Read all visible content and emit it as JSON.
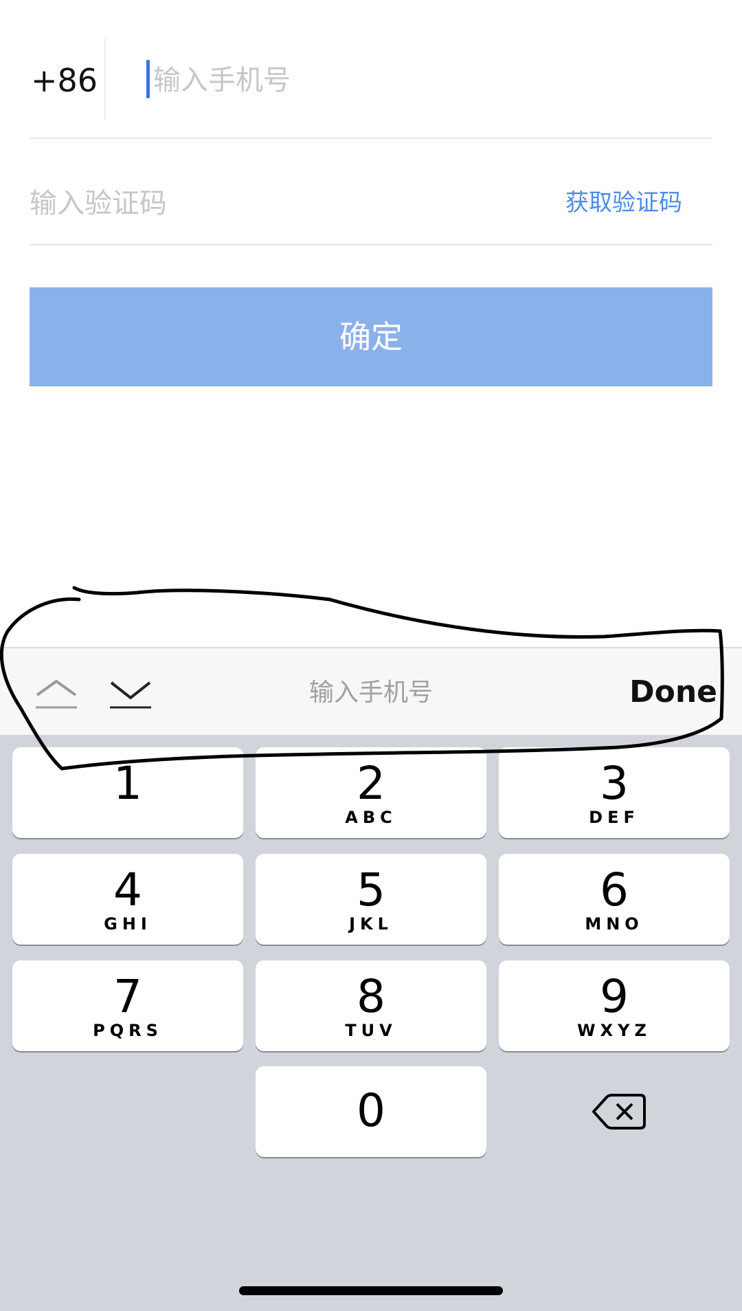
{
  "form": {
    "country_code": "+86",
    "phone_placeholder": "输入手机号",
    "code_placeholder": "输入验证码",
    "get_code_label": "获取验证码",
    "confirm_label": "确定"
  },
  "toolbar": {
    "prev_icon": "chevron-up-icon",
    "next_icon": "chevron-down-icon",
    "title": "输入手机号",
    "done_label": "Done"
  },
  "keypad": {
    "keys": [
      {
        "digit": "1",
        "letters": ""
      },
      {
        "digit": "2",
        "letters": "ABC"
      },
      {
        "digit": "3",
        "letters": "DEF"
      },
      {
        "digit": "4",
        "letters": "GHI"
      },
      {
        "digit": "5",
        "letters": "JKL"
      },
      {
        "digit": "6",
        "letters": "MNO"
      },
      {
        "digit": "7",
        "letters": "PQRS"
      },
      {
        "digit": "8",
        "letters": "TUV"
      },
      {
        "digit": "9",
        "letters": "WXYZ"
      },
      {
        "digit": "0",
        "letters": ""
      }
    ],
    "backspace_icon": "backspace-icon"
  },
  "colors": {
    "accent": "#4d8ce6",
    "button": "#8bb1eb",
    "caret": "#3f6fe6",
    "keyboard_bg": "#d1d4db"
  }
}
